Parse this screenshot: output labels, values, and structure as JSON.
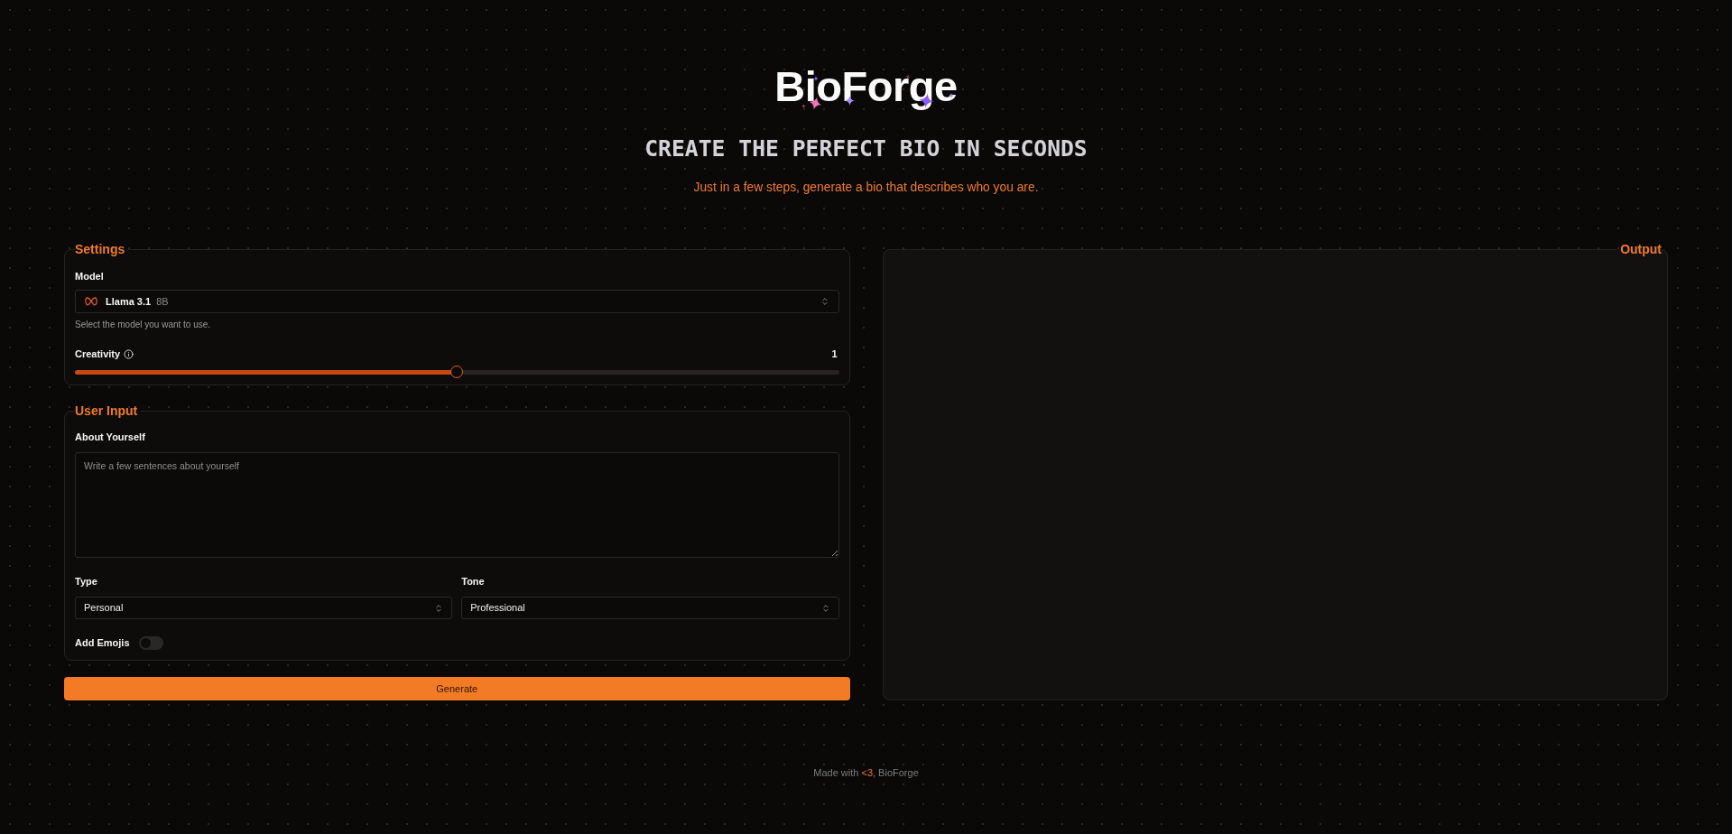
{
  "header": {
    "logo": "BioForge",
    "title": "CREATE THE PERFECT BIO IN SECONDS",
    "subtitle": "Just in a few steps, generate a bio that describes who you are."
  },
  "settings": {
    "legend": "Settings",
    "model": {
      "label": "Model",
      "value": "Llama 3.1",
      "size": "8B",
      "hint": "Select the model you want to use."
    },
    "creativity": {
      "label": "Creativity",
      "reading": "1",
      "level": 0.5
    }
  },
  "user_input": {
    "legend": "User Input",
    "about": {
      "label": "About Yourself",
      "placeholder": "Write a few sentences about yourself"
    },
    "selects": [
      {
        "label": "Type",
        "value": "Personal"
      },
      {
        "label": "Tone",
        "value": "Professional"
      }
    ],
    "emojis": {
      "label": "Add Emojis",
      "on": false
    }
  },
  "generate_button": "Generate",
  "output": {
    "legend": "Output"
  },
  "footer": {
    "text": "Made with **<3**, BioForge"
  }
}
